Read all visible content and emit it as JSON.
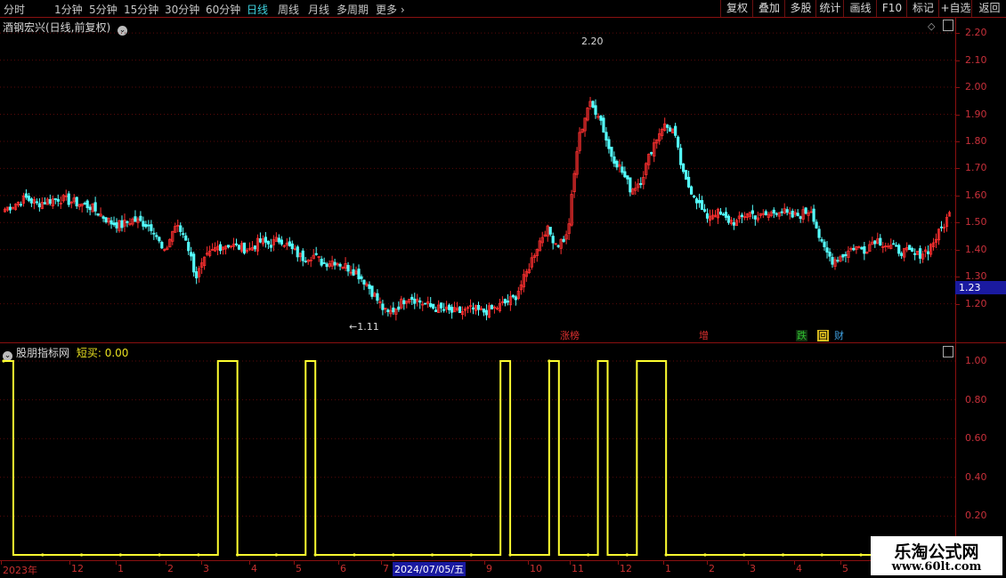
{
  "toolbar": {
    "periods": [
      "分时",
      "1分钟",
      "5分钟",
      "15分钟",
      "30分钟",
      "60分钟",
      "日线",
      "周线",
      "月线",
      "多周期",
      "更多"
    ],
    "active_period": "日线",
    "right_buttons": [
      "复权",
      "叠加",
      "多股",
      "统计",
      "画线",
      "F10",
      "标记",
      "+自选",
      "返回"
    ]
  },
  "main_panel": {
    "title": "酒钢宏兴(日线,前复权)",
    "high_label": "2.20",
    "low_label": "1.11",
    "current_price": "1.23",
    "y_axis": [
      "2.20",
      "2.10",
      "2.00",
      "1.90",
      "1.80",
      "1.70",
      "1.60",
      "1.50",
      "1.40",
      "1.30",
      "1.20"
    ],
    "tags": [
      {
        "text": "涨榜",
        "color": "#e03030"
      },
      {
        "text": "增",
        "color": "#e03030"
      },
      {
        "text": "跌",
        "color": "#30c030"
      },
      {
        "text": "回",
        "color": "#e0c020"
      },
      {
        "text": "财",
        "color": "#3fa0e0"
      }
    ]
  },
  "sub_panel": {
    "title": "股朋指标网",
    "indicator": "短买: 0.00",
    "y_axis": [
      "1.00",
      "0.80",
      "0.60",
      "0.40",
      "0.20"
    ]
  },
  "time_axis": {
    "labels": [
      "2023年",
      "12",
      "1",
      "2",
      "3",
      "4",
      "5",
      "6",
      "7",
      "9",
      "10",
      "11",
      "12",
      "1",
      "2",
      "3",
      "4",
      "5"
    ],
    "highlight": "2024/07/05/五"
  },
  "watermark": {
    "title": "乐淘公式网",
    "url": "www.60lt.com"
  },
  "chart_data": [
    {
      "type": "candlestick",
      "title": "酒钢宏兴(日线,前复权)",
      "ylim": [
        1.11,
        2.24
      ],
      "x_ticks": [
        "2023年",
        "12",
        "1",
        "2",
        "3",
        "4",
        "5",
        "6",
        "7",
        "2024/07/05/五",
        "9",
        "10",
        "11",
        "12",
        "1",
        "2",
        "3",
        "4",
        "5"
      ],
      "close": [
        1.55,
        1.57,
        1.59,
        1.57,
        1.58,
        1.59,
        1.58,
        1.57,
        1.56,
        1.53,
        1.5,
        1.49,
        1.51,
        1.5,
        1.48,
        1.38,
        1.49,
        1.45,
        1.3,
        1.37,
        1.41,
        1.42,
        1.41,
        1.4,
        1.43,
        1.42,
        1.44,
        1.4,
        1.37,
        1.38,
        1.35,
        1.36,
        1.34,
        1.32,
        1.28,
        1.22,
        1.16,
        1.19,
        1.23,
        1.21,
        1.19,
        1.18,
        1.17,
        1.17,
        1.18,
        1.17,
        1.18,
        1.2,
        1.22,
        1.3,
        1.4,
        1.48,
        1.42,
        1.45,
        1.8,
        1.94,
        1.9,
        1.76,
        1.7,
        1.62,
        1.66,
        1.78,
        1.86,
        1.84,
        1.66,
        1.6,
        1.52,
        1.54,
        1.51,
        1.5,
        1.54,
        1.52,
        1.53,
        1.55,
        1.52,
        1.53,
        1.55,
        1.41,
        1.36,
        1.38,
        1.41,
        1.4,
        1.44,
        1.42,
        1.4,
        1.39,
        1.38,
        1.4,
        1.46,
        1.53
      ],
      "labels": {
        "high": "2.20",
        "low": "1.11",
        "last": "1.23"
      }
    },
    {
      "type": "line",
      "title": "股朋指标网",
      "series": [
        {
          "name": "短买",
          "values": [
            1,
            0,
            0,
            0,
            0,
            0,
            0,
            0,
            0,
            0,
            0,
            0,
            0,
            0,
            0,
            0,
            0,
            0,
            0,
            0,
            0,
            0,
            1,
            1,
            0,
            0,
            0,
            0,
            0,
            0,
            0,
            1,
            0,
            0,
            0,
            0,
            0,
            0,
            0,
            0,
            0,
            0,
            0,
            0,
            0,
            0,
            0,
            0,
            0,
            0,
            0,
            1,
            0,
            0,
            0,
            0,
            1,
            0,
            0,
            0,
            0,
            1,
            0,
            0,
            0,
            1,
            1,
            1,
            0,
            0,
            0,
            0,
            0,
            0,
            0,
            0,
            0,
            0,
            0,
            0,
            0,
            0,
            0,
            0,
            0,
            0,
            0,
            0,
            0,
            0
          ]
        }
      ],
      "ylim": [
        0,
        1.0
      ]
    }
  ]
}
